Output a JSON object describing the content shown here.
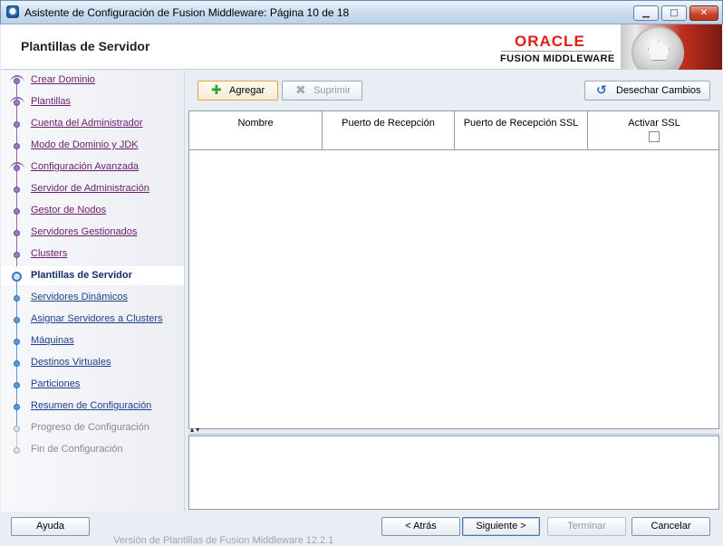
{
  "window": {
    "title": "Asistente de Configuración de Fusion Middleware: Página 10 de 18",
    "minimize": "▁",
    "maximize": "□",
    "close": "✕"
  },
  "header": {
    "title": "Plantillas de Servidor",
    "brand_oracle": "ORACLE",
    "brand_fusion": "FUSION MIDDLEWARE"
  },
  "nav": {
    "items": [
      {
        "label": "Crear Dominio",
        "state": "done"
      },
      {
        "label": "Plantillas",
        "state": "done"
      },
      {
        "label": "Cuenta del Administrador",
        "state": "done"
      },
      {
        "label": "Modo de Dominio y JDK",
        "state": "done"
      },
      {
        "label": "Configuración Avanzada",
        "state": "done"
      },
      {
        "label": "Servidor de Administración",
        "state": "done"
      },
      {
        "label": "Gestor de Nodos",
        "state": "done"
      },
      {
        "label": "Servidores Gestionados",
        "state": "done"
      },
      {
        "label": "Clusters",
        "state": "done"
      },
      {
        "label": "Plantillas de Servidor",
        "state": "active"
      },
      {
        "label": "Servidores Dinámicos",
        "state": "todo"
      },
      {
        "label": "Asignar Servidores a Clusters",
        "state": "todo"
      },
      {
        "label": "Máquinas",
        "state": "todo"
      },
      {
        "label": "Destinos Virtuales",
        "state": "todo"
      },
      {
        "label": "Particiones",
        "state": "todo"
      },
      {
        "label": "Resumen de Configuración",
        "state": "todo"
      },
      {
        "label": "Progreso de Configuración",
        "state": "disabled"
      },
      {
        "label": "Fin de Configuración",
        "state": "disabled"
      }
    ]
  },
  "toolbar": {
    "add_label": "Agregar",
    "delete_label": "Suprimir",
    "discard_label": "Desechar Cambios"
  },
  "table": {
    "columns": [
      "Nombre",
      "Puerto de Recepción",
      "Puerto de Recepción SSL",
      "Activar SSL"
    ],
    "rows": []
  },
  "footer": {
    "help": "Ayuda",
    "back": "< Atrás",
    "next": "Siguiente >",
    "finish": "Terminar",
    "cancel": "Cancelar",
    "underlay_text": "Versión de Plantillas de Fusion Middleware 12.2.1"
  },
  "colors": {
    "accent": "#3b78c2",
    "brand_red": "#e21e13",
    "visited_link": "#6b1e6e",
    "todo_link": "#1f3f8c"
  }
}
